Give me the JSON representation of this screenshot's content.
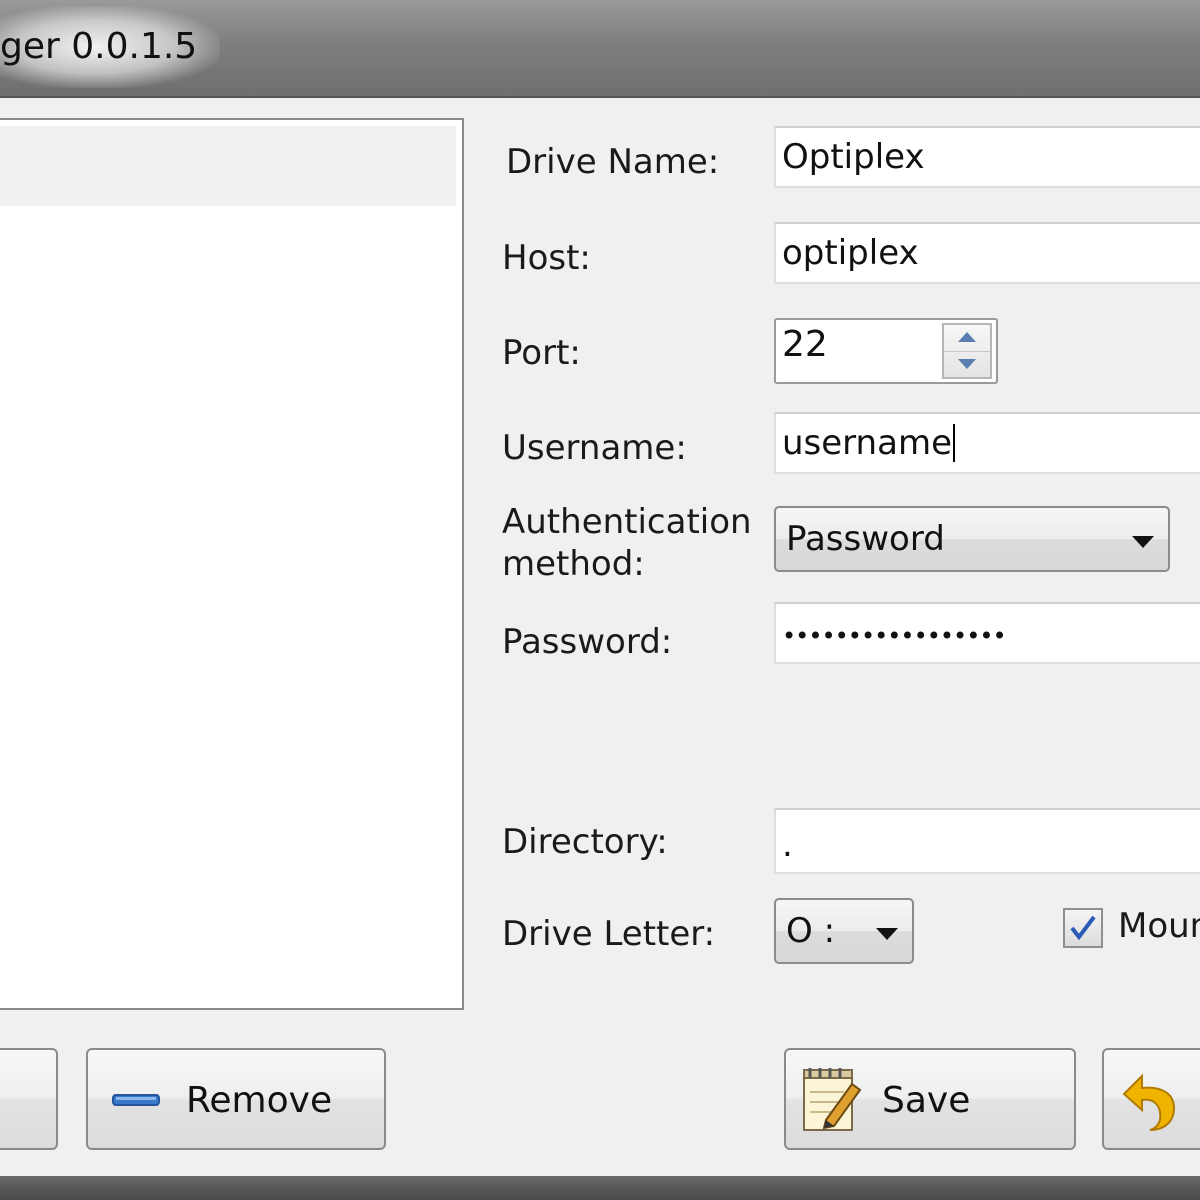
{
  "window": {
    "title": "ger 0.0.1.5"
  },
  "form": {
    "drive_name_label": "Drive Name:",
    "drive_name_value": "Optiplex",
    "host_label": "Host:",
    "host_value": "optiplex",
    "port_label": "Port:",
    "port_value": "22",
    "username_label": "Username:",
    "username_value": "username",
    "auth_label_line1": "Authentication",
    "auth_label_line2": "method:",
    "auth_value": "Password",
    "password_label": "Password:",
    "password_value": "•••••••••••••••••",
    "directory_label": "Directory:",
    "directory_value": ".",
    "drive_letter_label": "Drive Letter:",
    "drive_letter_value": "O :",
    "mount_checkbox_label": "Moun",
    "mount_checked": true
  },
  "buttons": {
    "remove_label": "Remove",
    "save_label": "Save"
  },
  "icons": {
    "remove": "minus-icon",
    "save": "notepad-pencil-icon",
    "revert": "undo-arrow-icon",
    "dropdown": "triangle-down-icon",
    "spin": "spin-arrows-icon"
  },
  "colors": {
    "title_bar": "#7e7e7e",
    "client_bg": "#f0f0f0",
    "checkbox_check": "#2a5ab8",
    "minus_icon": "#3a78c8",
    "undo_arrow": "#f0b400"
  }
}
